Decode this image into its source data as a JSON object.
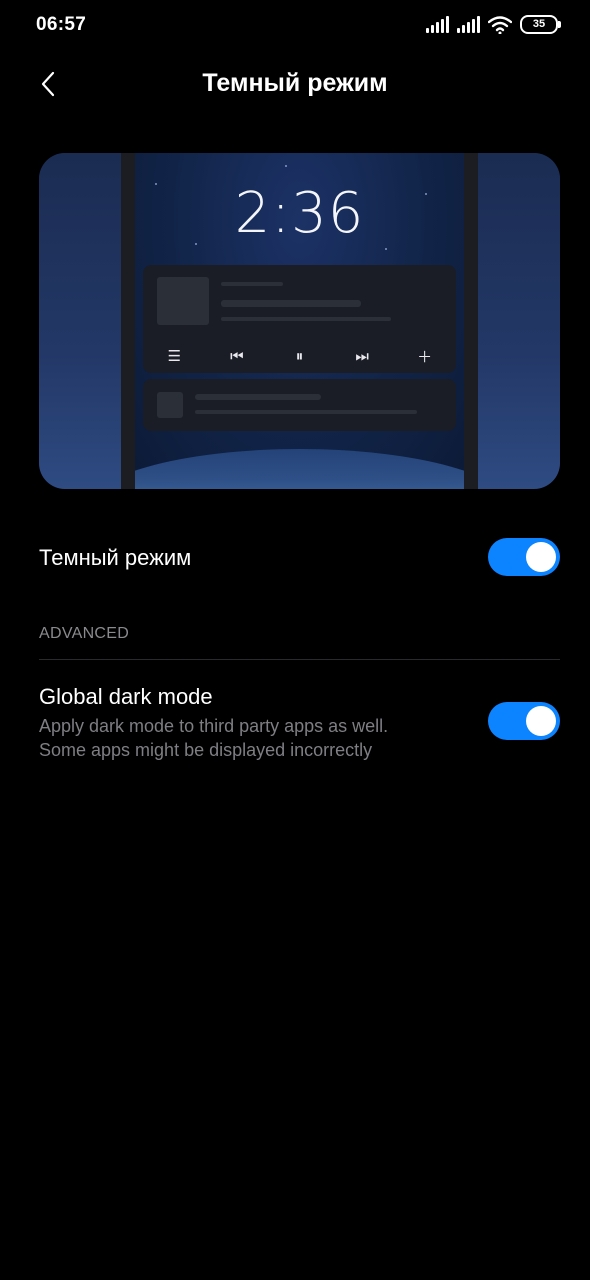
{
  "status_bar": {
    "time": "06:57",
    "battery": "35",
    "icons": [
      "signal-icon",
      "signal-icon",
      "wifi-icon",
      "battery-icon"
    ]
  },
  "header": {
    "back_icon": "chevron-left-icon",
    "title": "Темный режим"
  },
  "preview": {
    "clock": "2:36",
    "media_icons": [
      "queue-icon",
      "previous-icon",
      "pause-icon",
      "next-icon",
      "add-icon"
    ]
  },
  "settings": {
    "dark_mode": {
      "label": "Темный режим",
      "enabled": true
    },
    "section_header": "ADVANCED",
    "global_dark_mode": {
      "label": "Global dark mode",
      "description_line1": "Apply dark mode to third party apps as well.",
      "description_line2": "Some apps might be displayed incorrectly",
      "enabled": true
    }
  },
  "colors": {
    "background": "#000000",
    "accent": "#0d84ff",
    "secondary_text": "#7e7e83"
  }
}
